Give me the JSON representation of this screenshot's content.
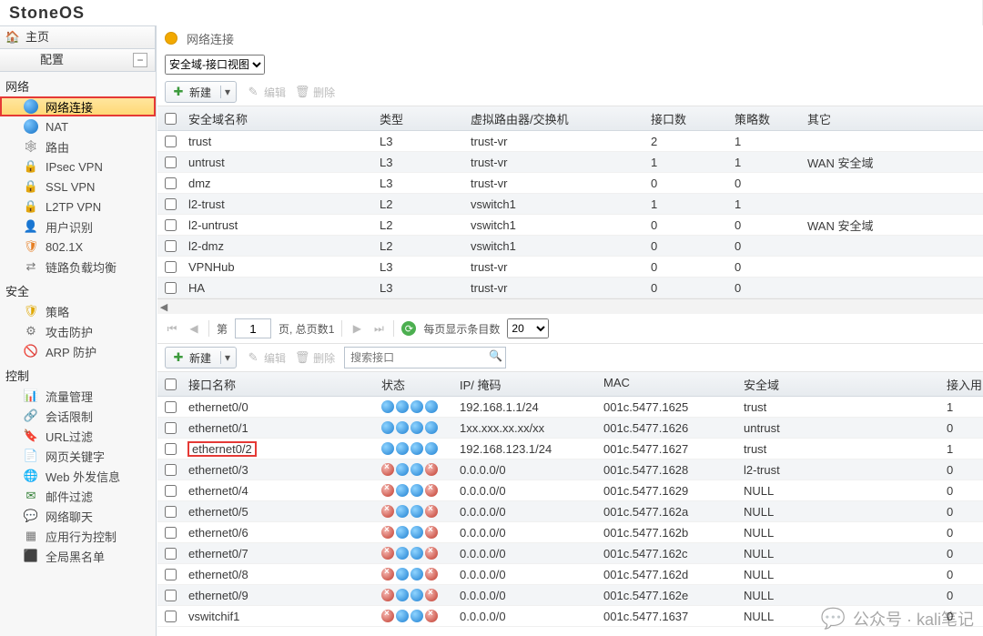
{
  "brand": "StoneOS",
  "sidebar": {
    "home": "主页",
    "configure": "配置",
    "groups": [
      {
        "label": "网络",
        "items": [
          {
            "id": "net-conn",
            "label": "网络连接",
            "icon": "globe",
            "active": true,
            "hl": true
          },
          {
            "id": "nat",
            "label": "NAT",
            "icon": "globe"
          },
          {
            "id": "route",
            "label": "路由",
            "icon": "route"
          },
          {
            "id": "ipsec",
            "label": "IPsec VPN",
            "icon": "vpn"
          },
          {
            "id": "sslvpn",
            "label": "SSL VPN",
            "icon": "vpn"
          },
          {
            "id": "l2tp",
            "label": "L2TP VPN",
            "icon": "vpn"
          },
          {
            "id": "userid",
            "label": "用户识别",
            "icon": "user"
          },
          {
            "id": "dot1x",
            "label": "802.1X",
            "icon": "802"
          },
          {
            "id": "llb",
            "label": "链路负载均衡",
            "icon": "llb"
          }
        ]
      },
      {
        "label": "安全",
        "items": [
          {
            "id": "policy",
            "label": "策略",
            "icon": "shield"
          },
          {
            "id": "attack",
            "label": "攻击防护",
            "icon": "attack"
          },
          {
            "id": "arp",
            "label": "ARP 防护",
            "icon": "arp"
          }
        ]
      },
      {
        "label": "控制",
        "items": [
          {
            "id": "traffic",
            "label": "流量管理",
            "icon": "flow"
          },
          {
            "id": "session",
            "label": "会话限制",
            "icon": "sess"
          },
          {
            "id": "urlf",
            "label": "URL过滤",
            "icon": "url"
          },
          {
            "id": "webkey",
            "label": "网页关键字",
            "icon": "key"
          },
          {
            "id": "webout",
            "label": "Web 外发信息",
            "icon": "web"
          },
          {
            "id": "mail",
            "label": "邮件过滤",
            "icon": "mail"
          },
          {
            "id": "chat",
            "label": "网络聊天",
            "icon": "chat"
          },
          {
            "id": "appctl",
            "label": "应用行为控制",
            "icon": "app"
          },
          {
            "id": "blk",
            "label": "全局黑名单",
            "icon": "black"
          }
        ]
      }
    ]
  },
  "page_title": "网络连接",
  "view_select": "安全域-接口视图",
  "buttons": {
    "new": "新建",
    "edit": "编辑",
    "delete": "删除"
  },
  "zone_table": {
    "headers": {
      "name": "安全域名称",
      "type": "类型",
      "vr": "虚拟路由器/交换机",
      "ifc": "接口数",
      "pol": "策略数",
      "other": "其它"
    },
    "rows": [
      {
        "name": "trust",
        "type": "L3",
        "vr": "trust-vr",
        "ifc": "2",
        "pol": "1",
        "other": ""
      },
      {
        "name": "untrust",
        "type": "L3",
        "vr": "trust-vr",
        "ifc": "1",
        "pol": "1",
        "other": "WAN 安全域"
      },
      {
        "name": "dmz",
        "type": "L3",
        "vr": "trust-vr",
        "ifc": "0",
        "pol": "0",
        "other": ""
      },
      {
        "name": "l2-trust",
        "type": "L2",
        "vr": "vswitch1",
        "ifc": "1",
        "pol": "1",
        "other": ""
      },
      {
        "name": "l2-untrust",
        "type": "L2",
        "vr": "vswitch1",
        "ifc": "0",
        "pol": "0",
        "other": "WAN 安全域"
      },
      {
        "name": "l2-dmz",
        "type": "L2",
        "vr": "vswitch1",
        "ifc": "0",
        "pol": "0",
        "other": ""
      },
      {
        "name": "VPNHub",
        "type": "L3",
        "vr": "trust-vr",
        "ifc": "0",
        "pol": "0",
        "other": ""
      },
      {
        "name": "HA",
        "type": "L3",
        "vr": "trust-vr",
        "ifc": "0",
        "pol": "0",
        "other": ""
      }
    ]
  },
  "pager": {
    "pre": "第",
    "page": "1",
    "mid": "页, 总页数",
    "total": "1",
    "perpage_label": "每页显示条目数",
    "perpage": "20"
  },
  "search_placeholder": "搜索接口",
  "if_table": {
    "headers": {
      "name": "接口名称",
      "state": "状态",
      "ip": "IP/ 掩码",
      "mac": "MAC",
      "zone": "安全域",
      "in": "接入用"
    },
    "rows": [
      {
        "name": "ethernet0/0",
        "up": true,
        "ip": "192.168.1.1/24",
        "mac": "001c.5477.1625",
        "zone": "trust",
        "in": "1",
        "hl": false
      },
      {
        "name": "ethernet0/1",
        "up": true,
        "ip": "1xx.xxx.xx.xx/xx",
        "mac": "001c.5477.1626",
        "zone": "untrust",
        "in": "0",
        "hl": false
      },
      {
        "name": "ethernet0/2",
        "up": true,
        "ip": "192.168.123.1/24",
        "mac": "001c.5477.1627",
        "zone": "trust",
        "in": "1",
        "hl": true
      },
      {
        "name": "ethernet0/3",
        "up": false,
        "ip": "0.0.0.0/0",
        "mac": "001c.5477.1628",
        "zone": "l2-trust",
        "in": "0",
        "hl": false
      },
      {
        "name": "ethernet0/4",
        "up": false,
        "ip": "0.0.0.0/0",
        "mac": "001c.5477.1629",
        "zone": "NULL",
        "in": "0",
        "hl": false
      },
      {
        "name": "ethernet0/5",
        "up": false,
        "ip": "0.0.0.0/0",
        "mac": "001c.5477.162a",
        "zone": "NULL",
        "in": "0",
        "hl": false
      },
      {
        "name": "ethernet0/6",
        "up": false,
        "ip": "0.0.0.0/0",
        "mac": "001c.5477.162b",
        "zone": "NULL",
        "in": "0",
        "hl": false
      },
      {
        "name": "ethernet0/7",
        "up": false,
        "ip": "0.0.0.0/0",
        "mac": "001c.5477.162c",
        "zone": "NULL",
        "in": "0",
        "hl": false
      },
      {
        "name": "ethernet0/8",
        "up": false,
        "ip": "0.0.0.0/0",
        "mac": "001c.5477.162d",
        "zone": "NULL",
        "in": "0",
        "hl": false
      },
      {
        "name": "ethernet0/9",
        "up": false,
        "ip": "0.0.0.0/0",
        "mac": "001c.5477.162e",
        "zone": "NULL",
        "in": "0",
        "hl": false
      },
      {
        "name": "vswitchif1",
        "up": false,
        "ip": "0.0.0.0/0",
        "mac": "001c.5477.1637",
        "zone": "NULL",
        "in": "0",
        "hl": false
      }
    ]
  },
  "watermark": "公众号 · kali笔记"
}
